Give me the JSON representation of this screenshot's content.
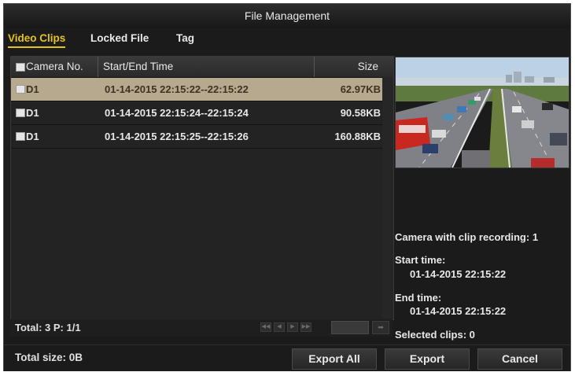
{
  "window": {
    "title": "File Management"
  },
  "tabs": [
    {
      "label": "Video Clips",
      "active": true
    },
    {
      "label": "Locked File",
      "active": false
    },
    {
      "label": "Tag",
      "active": false
    }
  ],
  "table": {
    "columns": [
      "Camera No.",
      "Start/End Time",
      "Size"
    ],
    "rows": [
      {
        "camera": "D1",
        "time": "01-14-2015 22:15:22--22:15:22",
        "size": "62.97KB",
        "selected": true
      },
      {
        "camera": "D1",
        "time": "01-14-2015 22:15:24--22:15:24",
        "size": "90.58KB",
        "selected": false
      },
      {
        "camera": "D1",
        "time": "01-14-2015 22:15:25--22:15:26",
        "size": "160.88KB",
        "selected": false
      }
    ]
  },
  "pagination": {
    "total_label": "Total: 3  P: 1/1",
    "page_input": ""
  },
  "info": {
    "camera_label": "Camera with clip recording: 1",
    "start_label": "Start time:",
    "start_value": "01-14-2015 22:15:22",
    "end_label": "End time:",
    "end_value": "01-14-2015 22:15:22",
    "selected_label": "Selected clips: 0"
  },
  "footer": {
    "total_size": "Total size: 0B",
    "export_all": "Export All",
    "export": "Export",
    "cancel": "Cancel"
  },
  "colors": {
    "accent": "#e8c21c",
    "selected_row": "#b7a98d",
    "background": "#1b1b1b"
  }
}
